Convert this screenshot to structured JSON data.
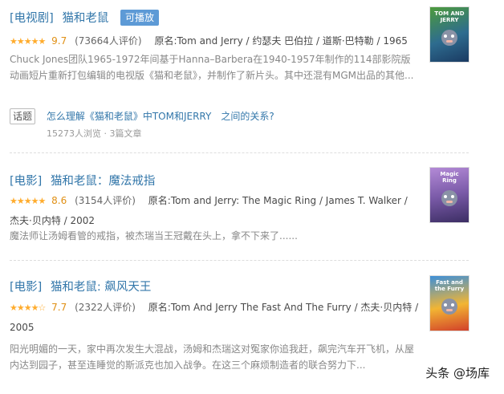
{
  "results": [
    {
      "category": "[电视剧]",
      "title": "猫和老鼠",
      "badge": "可播放",
      "stars": "★★★★★",
      "rating": "9.7",
      "votes": "(73664人评价)",
      "original": "原名:Tom and Jerry / 约瑟夫 巴伯拉 / 道斯·巴特勒 / 1965",
      "description": "Chuck Jones团队1965-1972年间基于Hanna–Barbera在1940-1957年制作的114部影院版动画短片重新打包编辑的电视版《猫和老鼠》，并制作了新片头。其中还混有MGM出品的其他...",
      "poster_title": "TOM AND JERRY",
      "topic": {
        "tag": "话题",
        "question": "怎么理解《猫和老鼠》中TOM和JERRY　之间的关系?",
        "stats": "15273人浏览 · 3篇文章"
      }
    },
    {
      "category": "[电影]",
      "title": "猫和老鼠：魔法戒指",
      "stars": "★★★★★",
      "rating": "8.6",
      "votes": "(3154人评价)",
      "original": "原名:Tom and Jerry: The Magic Ring / James T. Walker / 杰夫·贝内特 / 2002",
      "description": "魔法师让汤姆看管的戒指，被杰瑞当王冠戴在头上，拿不下来了......",
      "poster_title": "Magic Ring"
    },
    {
      "category": "[电影]",
      "title": "猫和老鼠: 飙风天王",
      "stars": "★★★★☆",
      "rating": "7.7",
      "votes": "(2322人评价)",
      "original": "原名:Tom And Jerry The Fast And The Furry / 杰夫·贝内特 / 2005",
      "description": "阳光明媚的一天，家中再次发生大混战，汤姆和杰瑞这对冤家你追我赶，飙完汽车开飞机，从屋内达到园子，甚至连睡觉的斯派克也加入战争。在这三个麻烦制造者的联合努力下...",
      "poster_title": "Fast and the Furry"
    }
  ],
  "watermark": "头条 @场库"
}
